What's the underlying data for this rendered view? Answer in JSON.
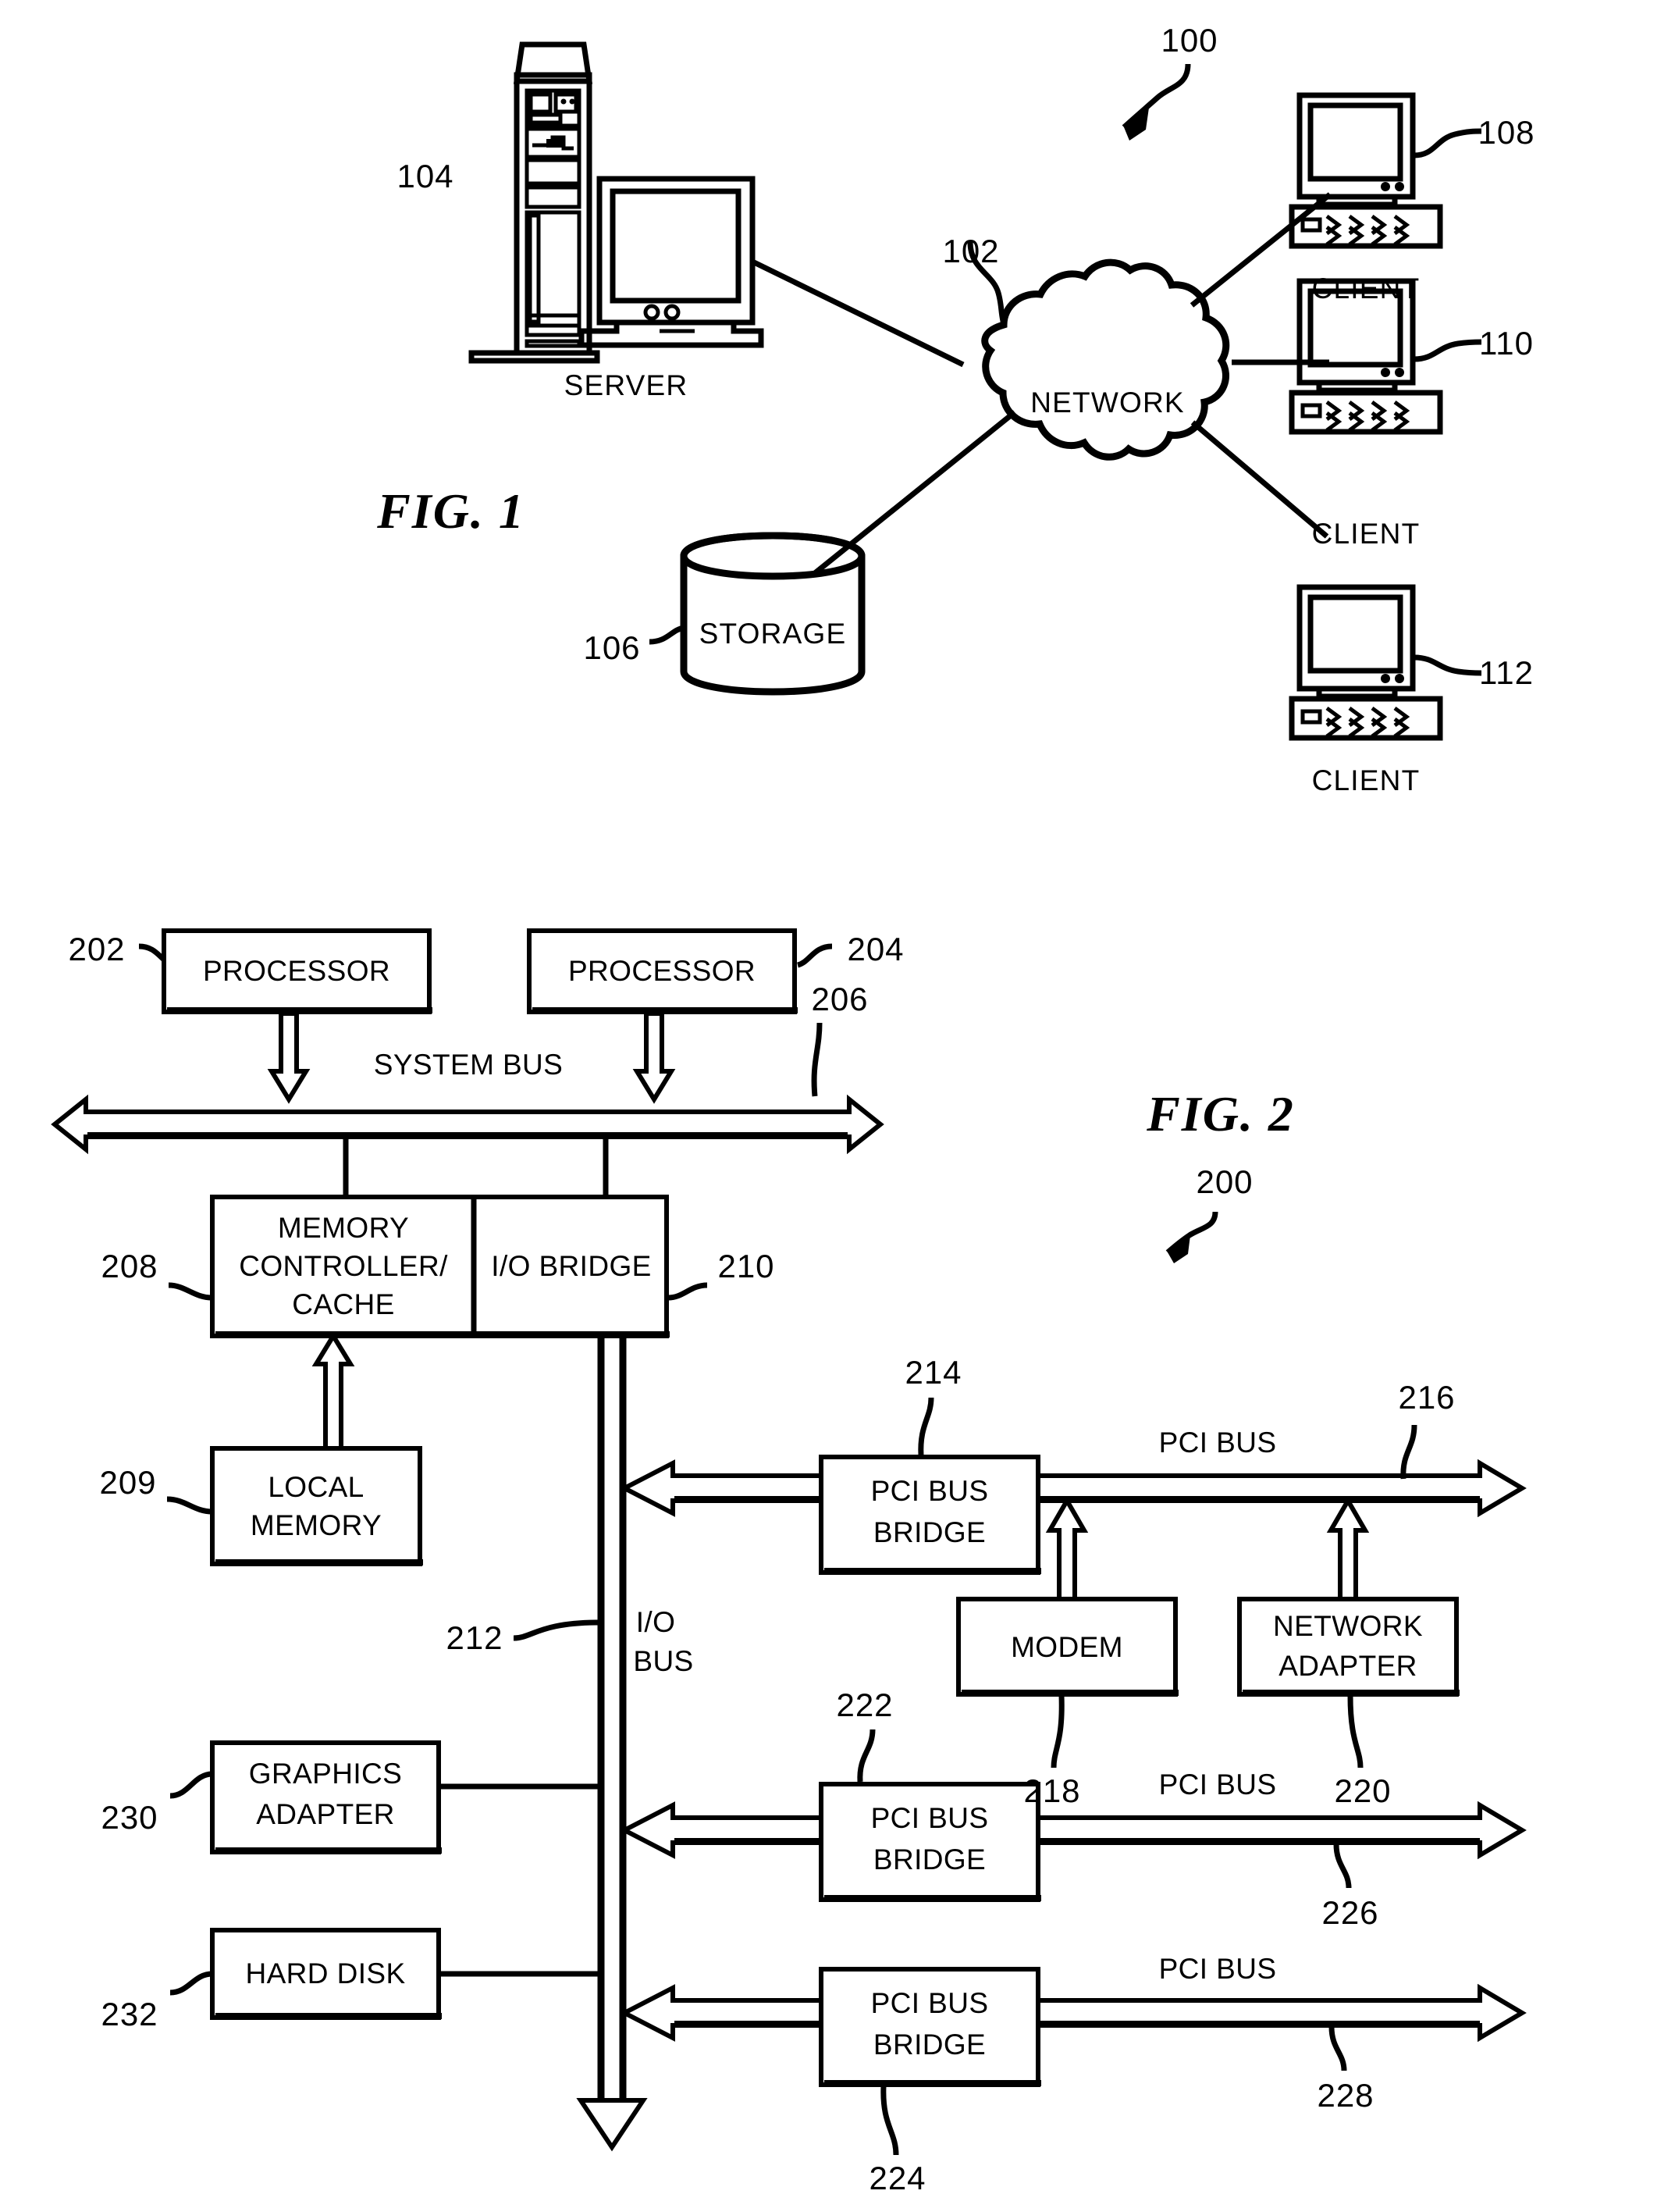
{
  "figures": [
    {
      "id": "fig1",
      "caption": "FIG. 1",
      "system_ref": "100",
      "nodes": {
        "server": {
          "label": "SERVER",
          "ref": "104"
        },
        "network": {
          "label": "NETWORK",
          "ref": "102"
        },
        "storage": {
          "label": "STORAGE",
          "ref": "106"
        },
        "client1": {
          "label": "CLIENT",
          "ref": "108"
        },
        "client2": {
          "label": "CLIENT",
          "ref": "110"
        },
        "client3": {
          "label": "CLIENT",
          "ref": "112"
        }
      }
    },
    {
      "id": "fig2",
      "caption": "FIG. 2",
      "system_ref": "200",
      "blocks": {
        "processor1": {
          "label": "PROCESSOR",
          "ref": "202"
        },
        "processor2": {
          "label": "PROCESSOR",
          "ref": "204"
        },
        "system_bus": {
          "label": "SYSTEM BUS",
          "ref": "206"
        },
        "memory_controller": {
          "label": "MEMORY\nCONTROLLER/\nCACHE",
          "line1": "MEMORY",
          "line2": "CONTROLLER/",
          "line3": "CACHE",
          "ref": "208"
        },
        "io_bridge": {
          "label": "I/O BRIDGE",
          "ref": "210"
        },
        "local_memory": {
          "line1": "LOCAL",
          "line2": "MEMORY",
          "ref": "209"
        },
        "io_bus": {
          "line1": "I/O",
          "line2": "BUS",
          "ref": "212"
        },
        "pci_bridge_1": {
          "line1": "PCI BUS",
          "line2": "BRIDGE",
          "ref": "214"
        },
        "pci_bus_1": {
          "label": "PCI BUS",
          "ref": "216"
        },
        "modem": {
          "label": "MODEM",
          "ref": "218"
        },
        "network_adapter": {
          "line1": "NETWORK",
          "line2": "ADAPTER",
          "ref": "220"
        },
        "pci_bridge_2": {
          "line1": "PCI BUS",
          "line2": "BRIDGE",
          "ref": "222"
        },
        "pci_bus_2": {
          "label": "PCI BUS",
          "ref": "226"
        },
        "pci_bridge_3": {
          "line1": "PCI BUS",
          "line2": "BRIDGE",
          "ref": "224"
        },
        "pci_bus_3": {
          "label": "PCI BUS",
          "ref": "228"
        },
        "graphics_adapter": {
          "line1": "GRAPHICS",
          "line2": "ADAPTER",
          "ref": "230"
        },
        "hard_disk": {
          "label": "HARD DISK",
          "ref": "232"
        }
      }
    }
  ],
  "colors": {
    "ink": "#000000",
    "paper": "#ffffff"
  }
}
